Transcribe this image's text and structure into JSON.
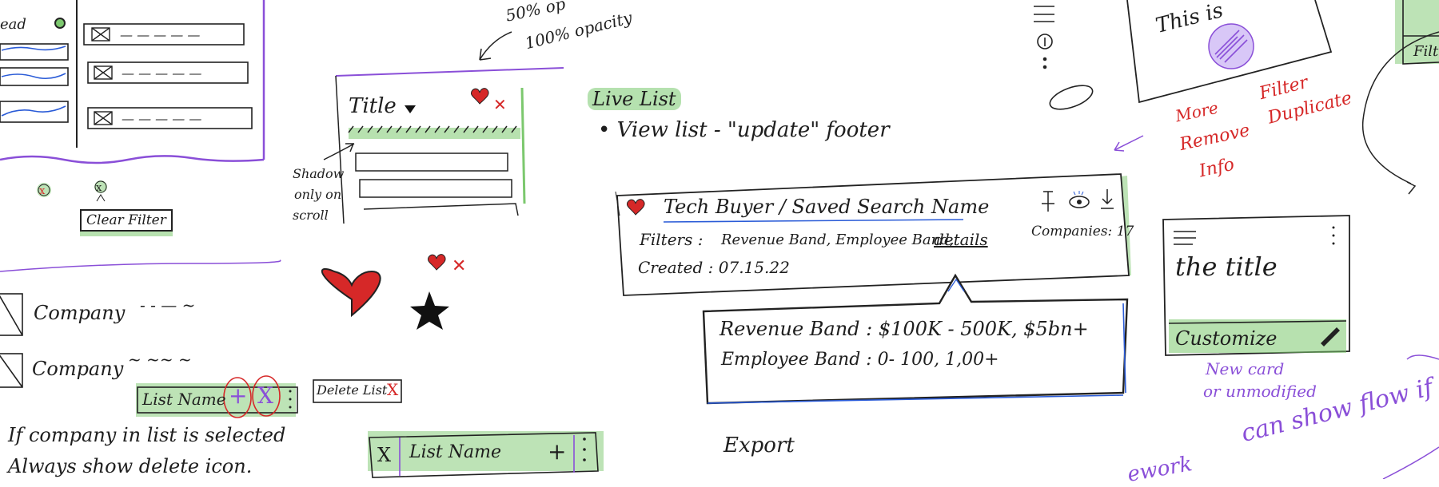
{
  "annotations": {
    "opacity_1": "50% op",
    "opacity_2": "100% opacity",
    "shadow": [
      "Shadow",
      "only on",
      "scroll"
    ],
    "clear_filter": "Clear Filter",
    "live_list": "Live List",
    "view_list": "• View list - \"update\" footer",
    "export": "Export",
    "this_is": "This is",
    "more_remove_info": [
      "More",
      "Remove",
      "Info"
    ],
    "filter_duplicate": [
      "Filter",
      "Duplicate"
    ],
    "new_card": [
      "New card",
      "or unmodified"
    ],
    "bottom_purple": "can show flow if filters applied",
    "bottom_purple_left": "ework",
    "green_tab": "Filt"
  },
  "filter_panel": {
    "left_label": "ead",
    "items": [
      "— — — — —",
      "— — — — —",
      "— — — — —"
    ]
  },
  "title_card": {
    "title": "Title"
  },
  "saved_search": {
    "title": "Tech Buyer / Saved Search Name",
    "filters_label": "Filters :",
    "filters_value": "Revenue Band, Employee Band,",
    "details_link": "details",
    "created": "Created : 07.15.22",
    "companies": "Companies: 17"
  },
  "tooltip": {
    "revenue": "Revenue Band : $100K - 500K, $5bn+",
    "employee": "Employee Band : 0- 100, 1,00+"
  },
  "customize_card": {
    "title": "the title",
    "button": "Customize"
  },
  "companies": [
    {
      "name": "Company",
      "dashes": "-   -  —    ~"
    },
    {
      "name": "Company",
      "dashes": "~   ~~   ~"
    }
  ],
  "list_controls": {
    "list_name": "List Name",
    "plus": "+",
    "x": "X",
    "delete_list": "Delete List",
    "delete_x": "X"
  },
  "bottom_text": [
    "If company in list is selected",
    "Always show delete icon."
  ],
  "list_input": {
    "x": "X",
    "name": "List Name",
    "plus": "+"
  },
  "colors": {
    "highlight": "#7cc86e",
    "purple": "#8a4fd8",
    "red": "#d62828",
    "blue": "#2a5bd7"
  }
}
